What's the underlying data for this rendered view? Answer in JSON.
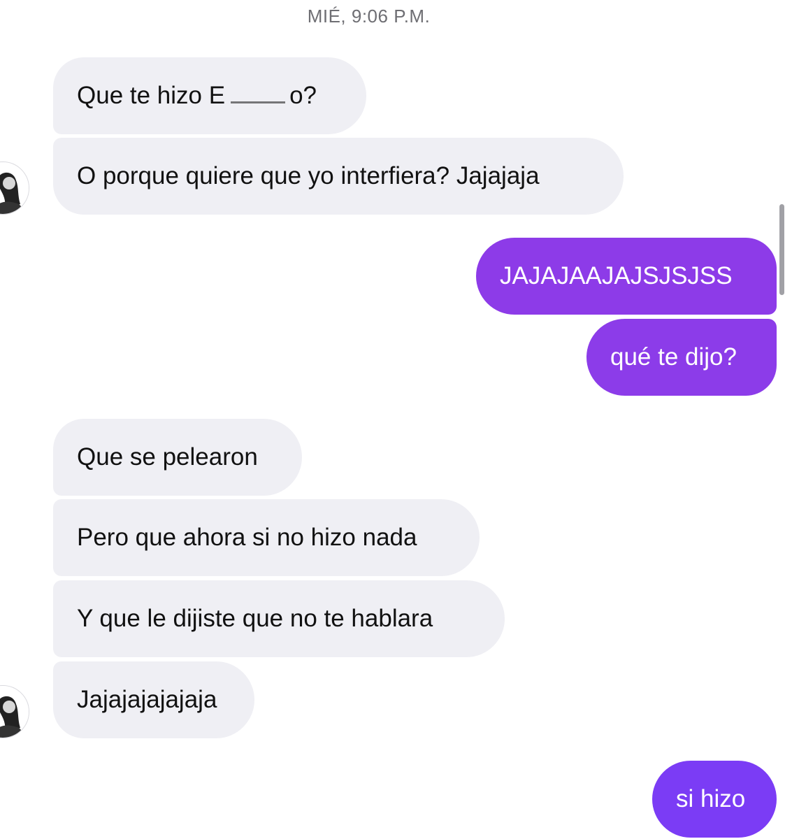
{
  "header": {
    "timestamp": "MIÉ, 9:06 P.M."
  },
  "colors": {
    "incoming_bg": "#efeff4",
    "outgoing_bg": "#8e3ae8",
    "outgoing_bg_alt": "#7b3cf5"
  },
  "messages": [
    {
      "sender": "other",
      "text": "Que te hizo E",
      "suffix": "o?"
    },
    {
      "sender": "other",
      "text": "O porque quiere que yo interfiera? Jajajaja"
    },
    {
      "sender": "me",
      "text": "JAJAJAAJAJSJSJSS"
    },
    {
      "sender": "me",
      "text": "qué te dijo?"
    },
    {
      "sender": "other",
      "text": "Que se pelearon"
    },
    {
      "sender": "other",
      "text": "Pero que ahora si no hizo nada"
    },
    {
      "sender": "other",
      "text": "Y que le dijiste que no te hablara"
    },
    {
      "sender": "other",
      "text": "Jajajajajajaja"
    },
    {
      "sender": "me",
      "text": "si hizo"
    }
  ]
}
